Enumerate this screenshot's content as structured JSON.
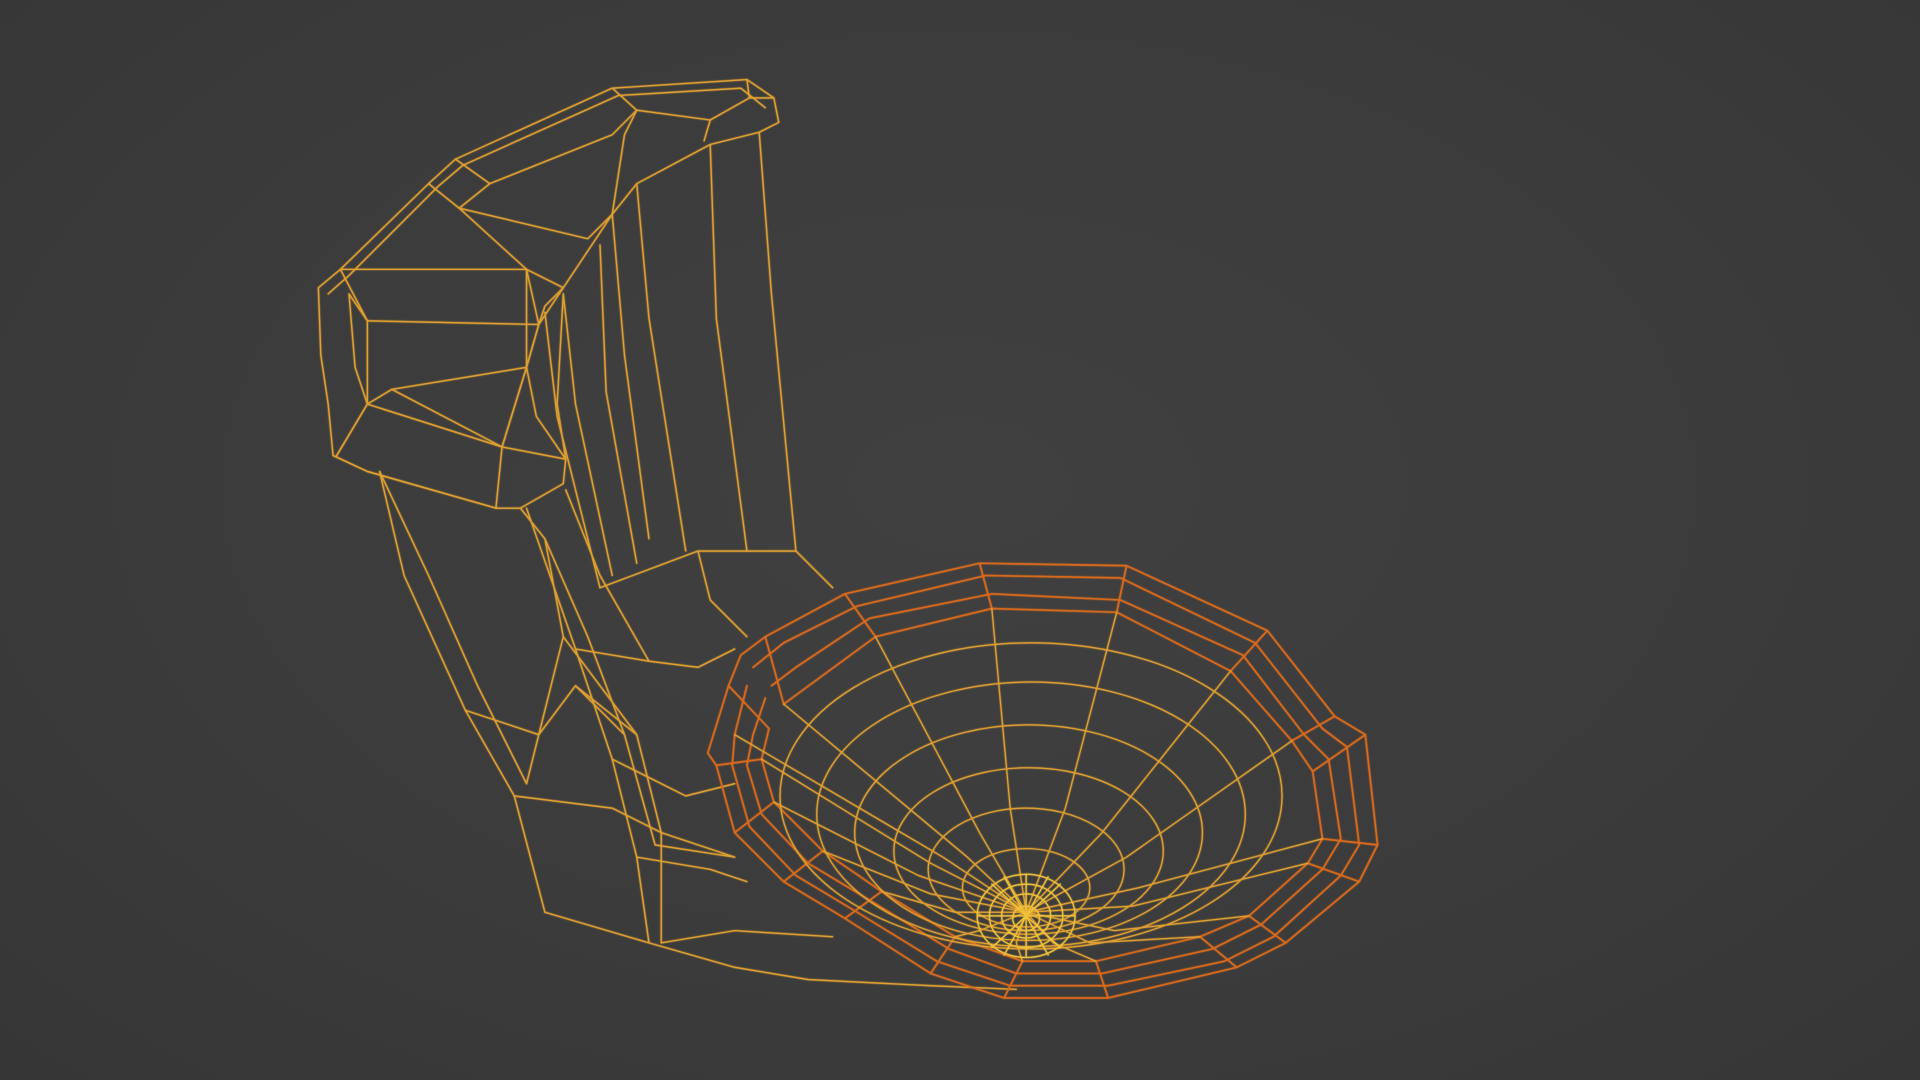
{
  "viewport": {
    "background": "#3d3d3d",
    "wire_color_primary": "#e0a030",
    "wire_color_secondary": "#d96a1e",
    "wire_color_highlight": "#f0c23a"
  },
  "scene": {
    "object": "toilet-wireframe-model"
  }
}
